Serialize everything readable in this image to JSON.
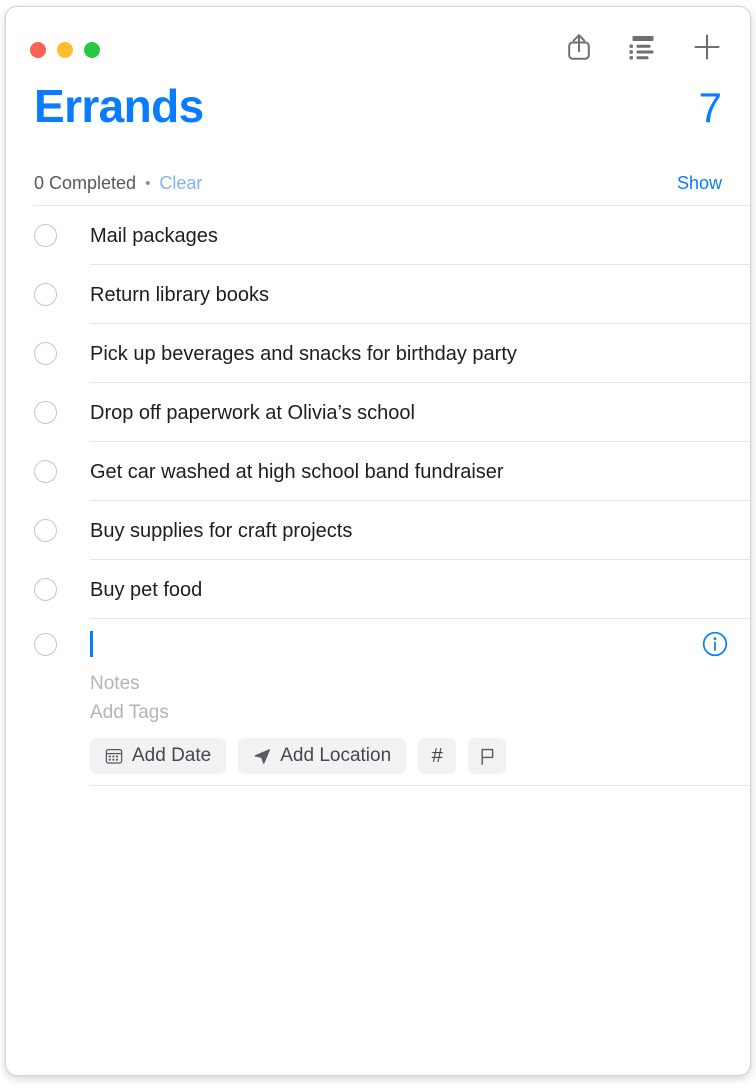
{
  "window": {
    "traffic_lights": [
      {
        "name": "close",
        "color": "#ff6159"
      },
      {
        "name": "minimize",
        "color": "#ffbd2e"
      },
      {
        "name": "maximize",
        "color": "#28c840"
      }
    ]
  },
  "toolbar": {
    "buttons": [
      {
        "icon": "share-icon",
        "label": "Share"
      },
      {
        "icon": "list-view-icon",
        "label": "View Options"
      },
      {
        "icon": "plus-icon",
        "label": "Add Reminder"
      }
    ]
  },
  "header": {
    "title": "Errands",
    "count": "7",
    "completed_text": "0 Completed",
    "separator_dot": "•",
    "clear_label": "Clear",
    "show_label": "Show",
    "accent_color": "#0a7cff",
    "clear_color": "#7fb4f2"
  },
  "reminders": [
    {
      "text": "Mail packages",
      "completed": false
    },
    {
      "text": "Return library books",
      "completed": false
    },
    {
      "text": "Pick up beverages and snacks for birthday party",
      "completed": false
    },
    {
      "text": "Drop off paperwork at Olivia’s school",
      "completed": false
    },
    {
      "text": "Get car washed at high school band fundraiser",
      "completed": false
    },
    {
      "text": "Buy supplies for craft projects",
      "completed": false
    },
    {
      "text": "Buy pet food",
      "completed": false
    }
  ],
  "new_item": {
    "title_value": "",
    "notes_placeholder": "Notes",
    "tags_placeholder": "Add Tags",
    "info_icon": "info-circle-icon",
    "attributes": [
      {
        "icon": "calendar-icon",
        "label": "Add Date"
      },
      {
        "icon": "location-arrow-icon",
        "label": "Add Location"
      },
      {
        "icon": "hashtag-icon",
        "label": "#"
      },
      {
        "icon": "flag-icon",
        "label": ""
      }
    ]
  }
}
